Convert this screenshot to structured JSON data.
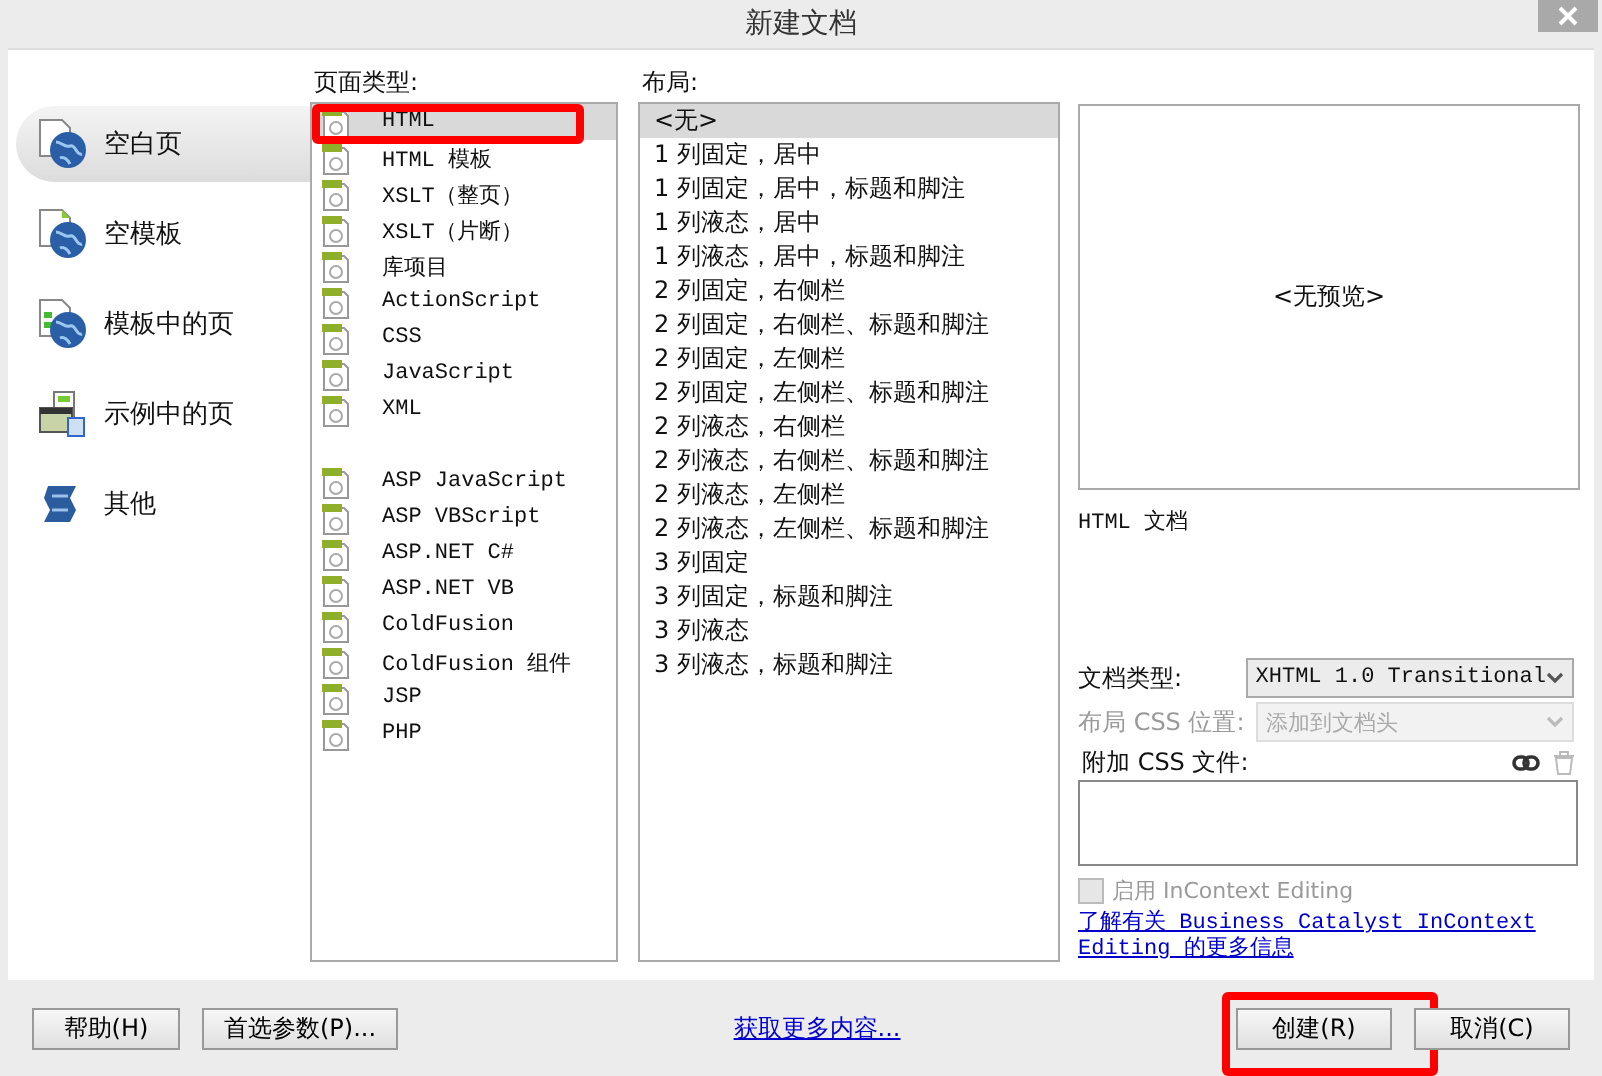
{
  "window": {
    "title": "新建文档"
  },
  "categories": [
    {
      "label": "空白页",
      "selected": true,
      "kind": "blank"
    },
    {
      "label": "空模板",
      "selected": false,
      "kind": "template"
    },
    {
      "label": "模板中的页",
      "selected": false,
      "kind": "templated"
    },
    {
      "label": "示例中的页",
      "selected": false,
      "kind": "sample"
    },
    {
      "label": "其他",
      "selected": false,
      "kind": "other"
    }
  ],
  "page_types": {
    "label": "页面类型:",
    "groups": [
      [
        {
          "label": "HTML",
          "selected": true,
          "highlighted": true
        },
        {
          "label": "HTML 模板",
          "selected": false,
          "highlighted": false
        },
        {
          "label": "XSLT（整页）",
          "selected": false,
          "highlighted": false
        },
        {
          "label": "XSLT（片断）",
          "selected": false,
          "highlighted": false
        },
        {
          "label": "库项目",
          "selected": false,
          "highlighted": false
        },
        {
          "label": "ActionScript",
          "selected": false,
          "highlighted": false
        },
        {
          "label": "CSS",
          "selected": false,
          "highlighted": false
        },
        {
          "label": "JavaScript",
          "selected": false,
          "highlighted": false
        },
        {
          "label": "XML",
          "selected": false,
          "highlighted": false
        }
      ],
      [
        {
          "label": "ASP JavaScript",
          "selected": false,
          "highlighted": false
        },
        {
          "label": "ASP VBScript",
          "selected": false,
          "highlighted": false
        },
        {
          "label": "ASP.NET C#",
          "selected": false,
          "highlighted": false
        },
        {
          "label": "ASP.NET VB",
          "selected": false,
          "highlighted": false
        },
        {
          "label": "ColdFusion",
          "selected": false,
          "highlighted": false
        },
        {
          "label": "ColdFusion 组件",
          "selected": false,
          "highlighted": false
        },
        {
          "label": "JSP",
          "selected": false,
          "highlighted": false
        },
        {
          "label": "PHP",
          "selected": false,
          "highlighted": false
        }
      ]
    ]
  },
  "layouts": {
    "label": "布局:",
    "items": [
      {
        "label": "<无>",
        "selected": true
      },
      {
        "label": "1 列固定，居中",
        "selected": false
      },
      {
        "label": "1 列固定，居中，标题和脚注",
        "selected": false
      },
      {
        "label": "1 列液态，居中",
        "selected": false
      },
      {
        "label": "1 列液态，居中，标题和脚注",
        "selected": false
      },
      {
        "label": "2 列固定，右侧栏",
        "selected": false
      },
      {
        "label": "2 列固定，右侧栏、标题和脚注",
        "selected": false
      },
      {
        "label": "2 列固定，左侧栏",
        "selected": false
      },
      {
        "label": "2 列固定，左侧栏、标题和脚注",
        "selected": false
      },
      {
        "label": "2 列液态，右侧栏",
        "selected": false
      },
      {
        "label": "2 列液态，右侧栏、标题和脚注",
        "selected": false
      },
      {
        "label": "2 列液态，左侧栏",
        "selected": false
      },
      {
        "label": "2 列液态，左侧栏、标题和脚注",
        "selected": false
      },
      {
        "label": "3 列固定",
        "selected": false
      },
      {
        "label": "3 列固定，标题和脚注",
        "selected": false
      },
      {
        "label": "3 列液态",
        "selected": false
      },
      {
        "label": "3 列液态，标题和脚注",
        "selected": false
      }
    ]
  },
  "preview": {
    "text": "<无预览>",
    "description": "HTML 文档"
  },
  "doctype": {
    "label": "文档类型:",
    "value": "XHTML 1.0 Transitional",
    "disabled": false
  },
  "layout_css": {
    "label": "布局 CSS 位置:",
    "value": "添加到文档头",
    "disabled": true
  },
  "attach_css": {
    "label": "附加 CSS 文件:"
  },
  "incontext": {
    "label": "启用 InContext Editing",
    "checked": false,
    "disabled": true
  },
  "info_link": "了解有关 Business Catalyst InContext Editing 的更多信息",
  "footer": {
    "left_buttons": [
      {
        "label": "帮助(H)",
        "highlighted": false
      },
      {
        "label": "首选参数(P)...",
        "highlighted": false
      }
    ],
    "more_link": "获取更多内容...",
    "right_buttons": [
      {
        "label": "创建(R)",
        "highlighted": true
      },
      {
        "label": "取消(C)",
        "highlighted": false
      }
    ]
  }
}
